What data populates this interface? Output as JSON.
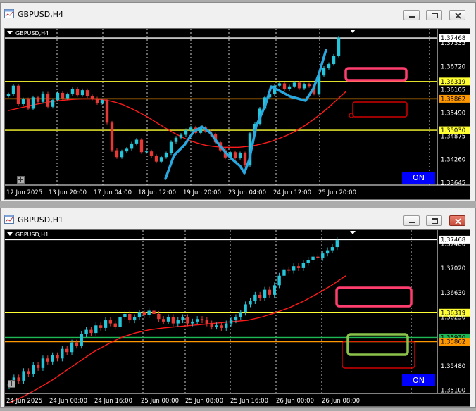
{
  "windows": [
    {
      "title": "GBPUSD,H4",
      "chart_label": "GBPUSD,H4",
      "on_label": "ON",
      "price_labels": [
        "1.37468",
        "1.37335",
        "1.36720",
        "1.36319",
        "1.36105",
        "1.35862",
        "1.35490",
        "1.35030",
        "1.34875",
        "1.34260",
        "1.33645"
      ],
      "time_labels": [
        "12 Jun 2025",
        "13 Jun 20:00",
        "17 Jun 04:00",
        "18 Jun 12:00",
        "19 Jun 20:00",
        "23 Jun 04:00",
        "24 Jun 12:00",
        "25 Jun 20:00"
      ]
    },
    {
      "title": "GBPUSD,H1",
      "chart_label": "GBPUSD,H1",
      "on_label": "ON",
      "price_labels": [
        "1.37468",
        "1.37400",
        "1.37020",
        "1.36630",
        "1.36319",
        "1.36250",
        "1.35930",
        "1.35862",
        "1.35480",
        "1.35100"
      ],
      "time_labels": [
        "24 Jun 2025",
        "24 Jun 08:00",
        "24 Jun 16:00",
        "25 Jun 00:00",
        "25 Jun 08:00",
        "25 Jun 16:00",
        "26 Jun 00:00",
        "26 Jun 08:00"
      ]
    }
  ],
  "colors": {
    "bull": "#26c6da",
    "bear": "#e53935",
    "ma": "#ff1a1a",
    "level_yellow": "#ffff33",
    "level_orange": "#ff9800",
    "level_green": "#1db954",
    "rect_pink": "#ff3d6e",
    "rect_red": "#d00000",
    "rect_lime": "#8bc34a",
    "drawing_blue": "#29a8e0"
  },
  "chart_data": [
    {
      "type": "candlestick",
      "symbol": "GBPUSD",
      "timeframe": "H4",
      "ylim": [
        1.3358,
        1.376
      ],
      "levels": [
        {
          "value": 1.36319,
          "color": "yellow"
        },
        {
          "value": 1.35862,
          "color": "orange"
        },
        {
          "value": 1.3503,
          "color": "yellow"
        },
        {
          "value": 1.37468,
          "color": "white"
        }
      ],
      "closes": [
        1.3598,
        1.3621,
        1.3572,
        1.3585,
        1.356,
        1.359,
        1.3578,
        1.36,
        1.3565,
        1.3583,
        1.3602,
        1.3588,
        1.3598,
        1.3612,
        1.3596,
        1.3609,
        1.3593,
        1.3587,
        1.3575,
        1.3583,
        1.3523,
        1.345,
        1.3432,
        1.3447,
        1.3454,
        1.3468,
        1.3478,
        1.3445,
        1.3447,
        1.3435,
        1.342,
        1.3432,
        1.3442,
        1.3472,
        1.3483,
        1.3491,
        1.3503,
        1.351,
        1.3496,
        1.351,
        1.35,
        1.3492,
        1.3471,
        1.345,
        1.3431,
        1.3445,
        1.343,
        1.3442,
        1.341,
        1.3495,
        1.352,
        1.356,
        1.359,
        1.3598,
        1.3621,
        1.3627,
        1.3612,
        1.3619,
        1.3629,
        1.3614,
        1.3624,
        1.362,
        1.36,
        1.3648,
        1.3668,
        1.3678,
        1.37,
        1.3748
      ],
      "ma": [
        1.3555,
        1.356,
        1.3565,
        1.357,
        1.3574,
        1.3578,
        1.3581,
        1.3583,
        1.3585,
        1.3586,
        1.3586,
        1.3585,
        1.3582,
        1.3577,
        1.357,
        1.356,
        1.3549,
        1.3537,
        1.3523,
        1.351,
        1.3497,
        1.3486,
        1.3476,
        1.3469,
        1.3463,
        1.346,
        1.3458,
        1.3458,
        1.3458,
        1.346,
        1.3463,
        1.3468,
        1.3474,
        1.3482,
        1.3491,
        1.3502,
        1.3515,
        1.353,
        1.3547,
        1.3565,
        1.3585,
        1.3605
      ]
    },
    {
      "type": "candlestick",
      "symbol": "GBPUSD",
      "timeframe": "H1",
      "ylim": [
        1.3505,
        1.3755
      ],
      "levels": [
        {
          "value": 1.36319,
          "color": "yellow"
        },
        {
          "value": 1.3593,
          "color": "green"
        },
        {
          "value": 1.35862,
          "color": "orange"
        },
        {
          "value": 1.37468,
          "color": "white"
        }
      ],
      "closes": [
        1.352,
        1.353,
        1.3525,
        1.354,
        1.3535,
        1.355,
        1.3545,
        1.356,
        1.3555,
        1.3565,
        1.356,
        1.3575,
        1.357,
        1.3585,
        1.358,
        1.3598,
        1.3605,
        1.36,
        1.3612,
        1.3608,
        1.362,
        1.3615,
        1.361,
        1.3625,
        1.363,
        1.362,
        1.3625,
        1.3632,
        1.3628,
        1.3635,
        1.363,
        1.3622,
        1.3618,
        1.3625,
        1.3615,
        1.362,
        1.3625,
        1.3615,
        1.3618,
        1.3622,
        1.362,
        1.3615,
        1.361,
        1.3612,
        1.3608,
        1.3615,
        1.362,
        1.3625,
        1.3632,
        1.3645,
        1.365,
        1.366,
        1.3655,
        1.3668,
        1.366,
        1.3675,
        1.369,
        1.37,
        1.3698,
        1.3705,
        1.3702,
        1.371,
        1.3715,
        1.372,
        1.3718,
        1.3725,
        1.373,
        1.3735,
        1.3746
      ],
      "ma": [
        1.349,
        1.35,
        1.3512,
        1.3525,
        1.354,
        1.3555,
        1.357,
        1.3582,
        1.3593,
        1.36,
        1.3605,
        1.3608,
        1.361,
        1.3612,
        1.3614,
        1.3616,
        1.3618,
        1.362,
        1.3625,
        1.3632,
        1.364,
        1.365,
        1.3662,
        1.3675,
        1.369
      ]
    }
  ]
}
